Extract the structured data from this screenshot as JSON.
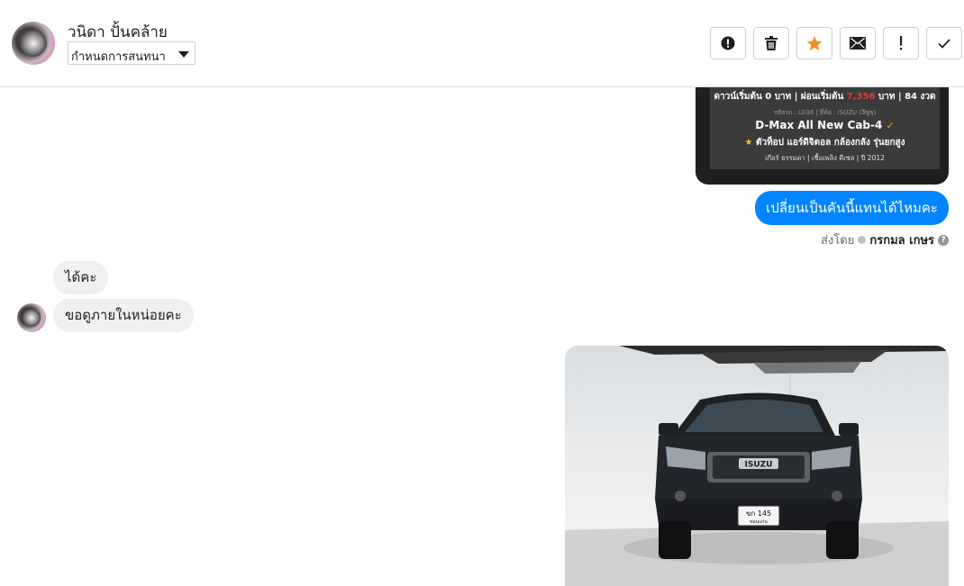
{
  "header": {
    "contact_name": "วนิดา ปั้นคล้าย",
    "select_value": "กำหนดการสนทนา",
    "toolbar": [
      {
        "icon": "alert-circle-icon",
        "name": "mark-spam-button"
      },
      {
        "icon": "trash-icon",
        "name": "delete-button"
      },
      {
        "icon": "star-icon",
        "name": "star-button"
      },
      {
        "icon": "envelope-icon",
        "name": "mark-unread-button"
      },
      {
        "icon": "exclamation-icon",
        "name": "follow-up-button"
      },
      {
        "icon": "check-icon",
        "name": "done-button"
      }
    ],
    "star_color": "#f28c28"
  },
  "promo": {
    "line1_a": "ดาวน์เริ่มต้น 0 บาท | ผ่อนเริ่มต้น",
    "line1_price": "7,356",
    "line1_b": "บาท | 84 งวด",
    "line2": "รหัสรถ : L038 | ยี่ห้อ : ISUZU (อีซูซุ)",
    "line3": "D-Max All New Cab-4",
    "line4": "ตัวท็อป แอร์ดิจิตอล กล้องกลัง รุ่นยกสูง",
    "line5": "เกียร์ ธรรมดา | เชื้อเพลิง ดีเซล | ปี 2012"
  },
  "outgoing_message": "เปลี่ยนเป็นคันนี้แทนได้ไหมคะ",
  "sent_by": {
    "label": "ส่งโดย",
    "name": "กรกมล เกษร"
  },
  "incoming_messages": [
    "ได้คะ",
    "ขอดูภายในหน่อยคะ"
  ],
  "photo": {
    "plate_line1": "ขก 145",
    "plate_line2": "ขอนแก่น",
    "grille_badge": "ISUZU"
  },
  "colors": {
    "accent": "#0084ff",
    "promo_price": "#e53935"
  }
}
